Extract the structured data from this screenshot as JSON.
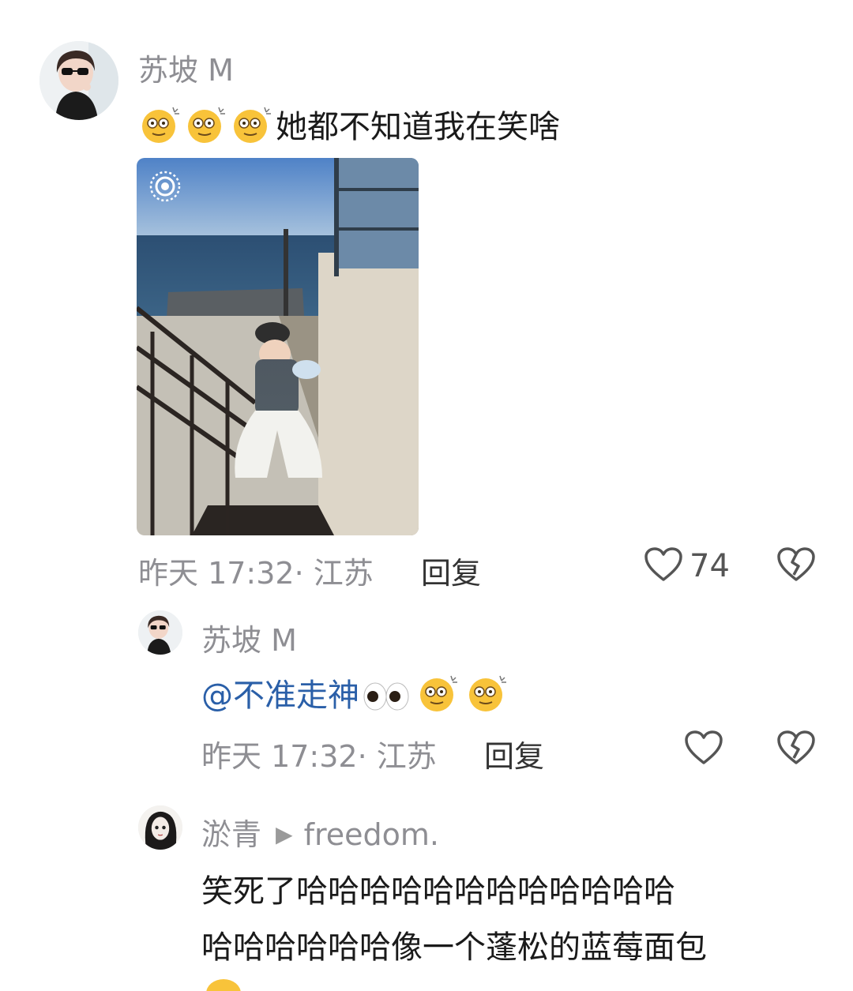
{
  "comment1": {
    "username": "苏坡 M",
    "text": "她都不知道我在笑啥",
    "emoji_prefix": [
      "dizzy-face-emoji",
      "dizzy-face-emoji",
      "dizzy-face-emoji"
    ],
    "meta": "昨天 17:32· 江苏",
    "reply_label": "回复",
    "like_count": "74"
  },
  "reply1": {
    "username": "苏坡 M",
    "mention": "@不准走神",
    "emoji_suffix": [
      "eyes-emoji",
      "dizzy-face-emoji",
      "dizzy-face-emoji"
    ],
    "meta": "昨天 17:32· 江苏",
    "reply_label": "回复"
  },
  "reply2": {
    "username": "淤青",
    "reply_to": "freedom.",
    "text_line1": "笑死了哈哈哈哈哈哈哈哈哈哈哈哈",
    "text_line2": "哈哈哈哈哈哈像一个蓬松的蓝莓面包"
  },
  "colors": {
    "username": "#8e8e93",
    "mention": "#2a5fa8",
    "body": "#1a1a1a"
  }
}
